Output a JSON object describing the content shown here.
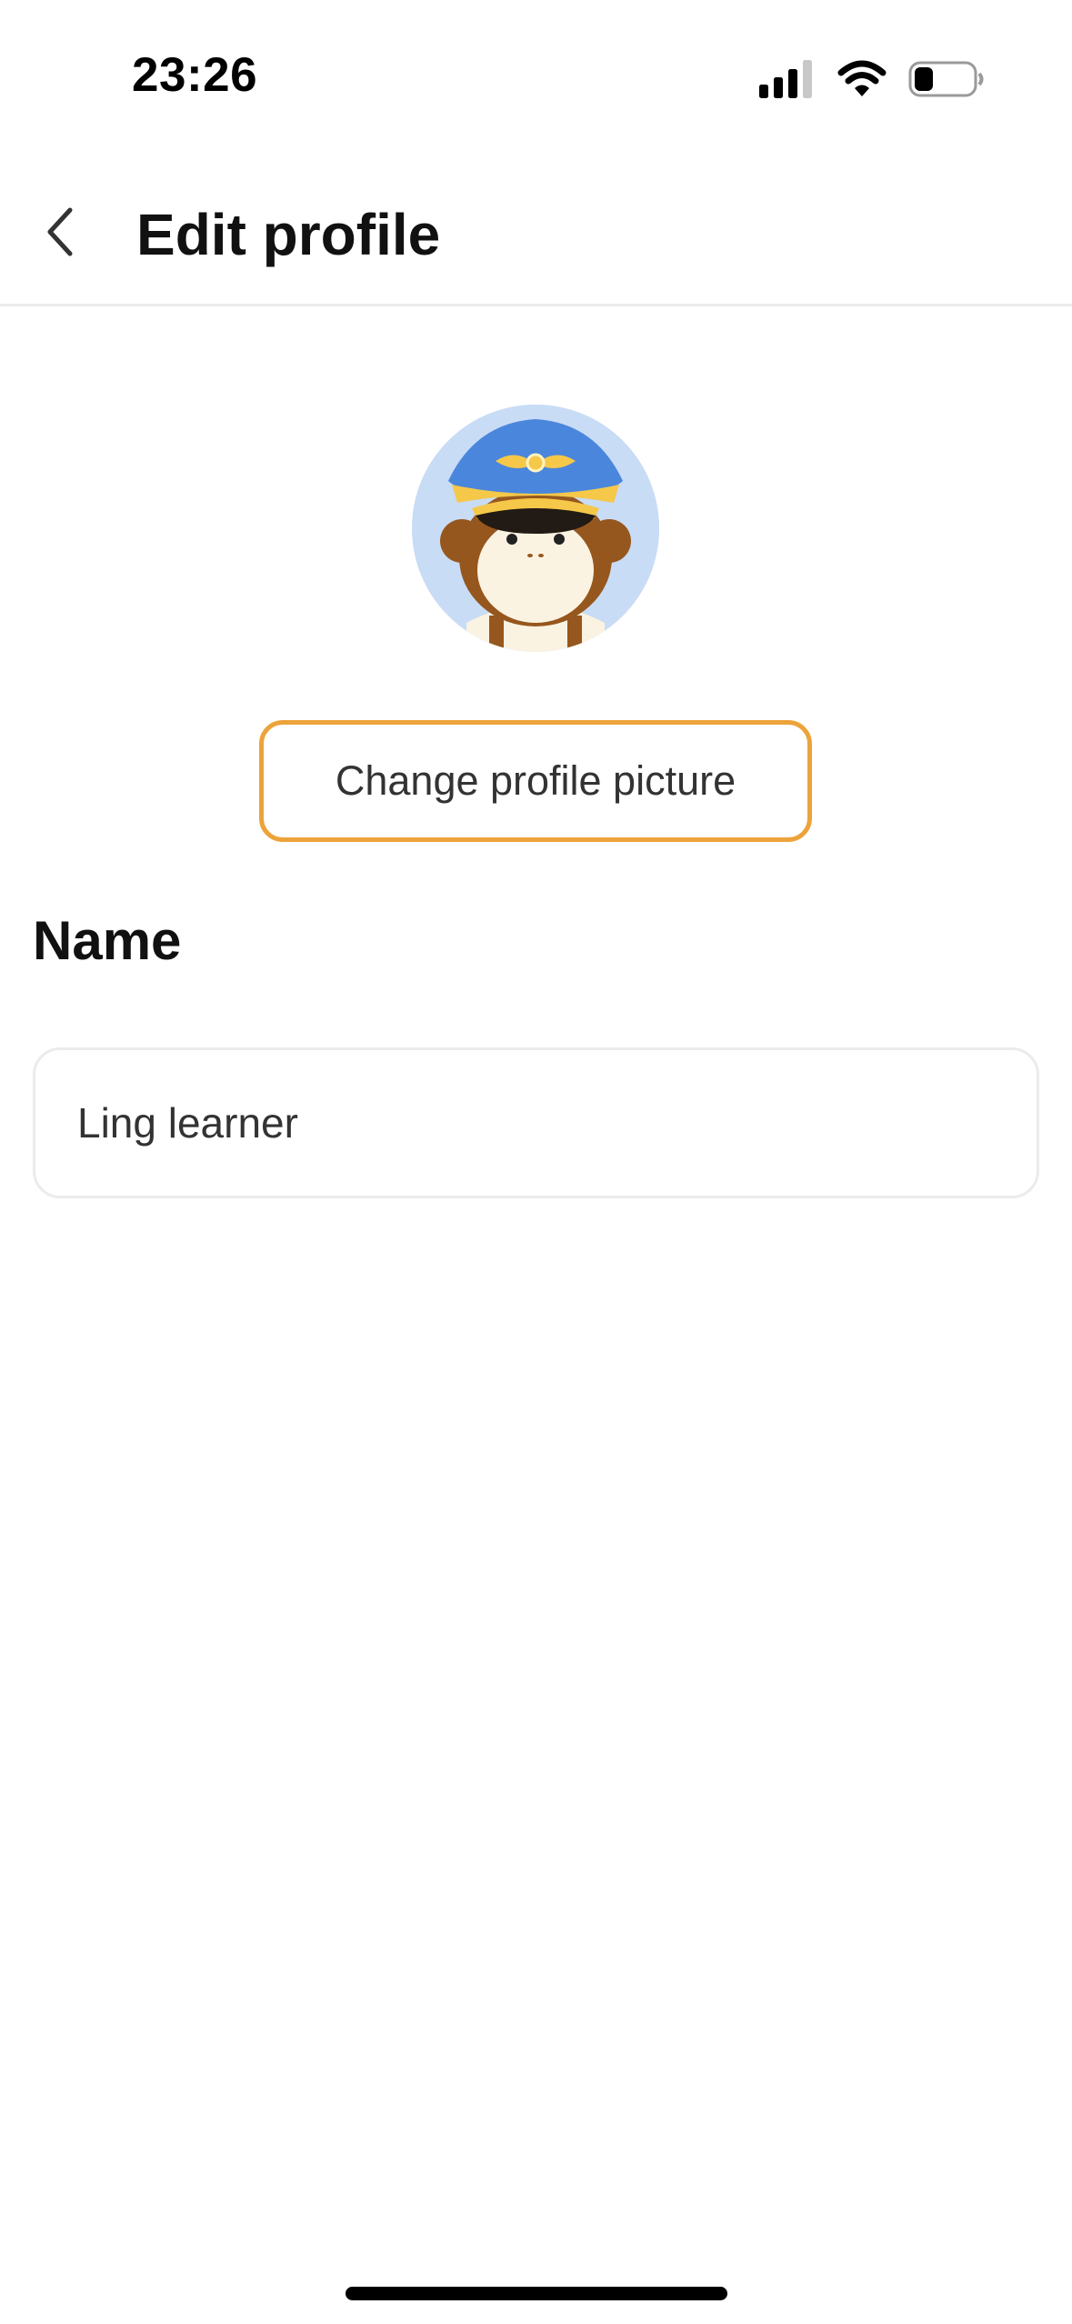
{
  "status_bar": {
    "time": "23:26",
    "icons": [
      "cellular-signal-icon",
      "wifi-icon",
      "battery-icon"
    ]
  },
  "header": {
    "back_icon": "chevron-left-icon",
    "title": "Edit profile"
  },
  "profile": {
    "avatar": "monkey-pilot-avatar",
    "change_picture_label": "Change profile picture",
    "name_label": "Name",
    "name_value": "Ling learner"
  },
  "colors": {
    "accent": "#eda33b",
    "avatar_bg": "#c8dcf6",
    "divider": "#ececec"
  }
}
